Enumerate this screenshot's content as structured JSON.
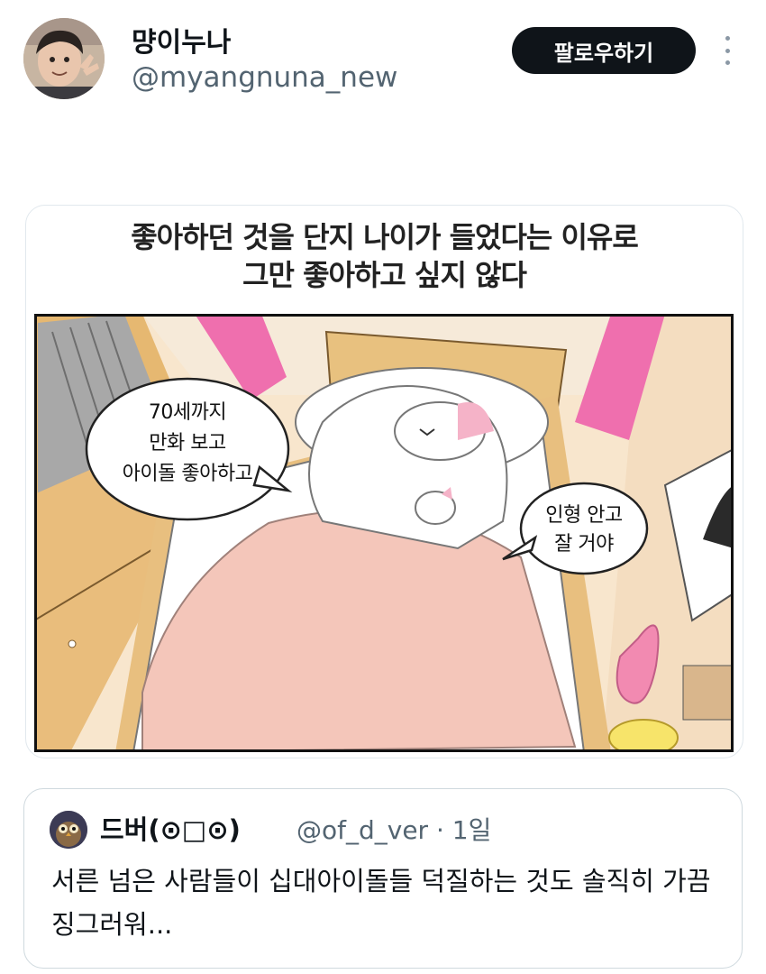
{
  "author": {
    "name": "먕이누나",
    "handle": "@myangnuna_new"
  },
  "follow_label": "팔로우하기",
  "media": {
    "caption_line1": "좋아하던 것을 단지 나이가 들었다는 이유로",
    "caption_line2": "그만 좋아하고 싶지 않다",
    "bubble_left": [
      "70세까지",
      "만화 보고",
      "아이돌 좋아하고"
    ],
    "bubble_right": [
      "인형 안고",
      "잘 거야"
    ]
  },
  "quote": {
    "name": "드버(⊙□⊙)",
    "handle": "@of_d_ver · 1일",
    "text": "서른 넘은 사람들이 십대아이돌들 덕질하는 것도 솔직히 가끔 징그러워..."
  },
  "colors": {
    "follow_bg": "#0f1419",
    "bubble_stroke": "#222222",
    "curtain_pink": "#ef6fae",
    "blanket": "#f4c6ba",
    "wall": "#f8e6cd",
    "wood": "#e6b871"
  },
  "icons": {
    "more": "vertical-ellipsis-icon"
  }
}
